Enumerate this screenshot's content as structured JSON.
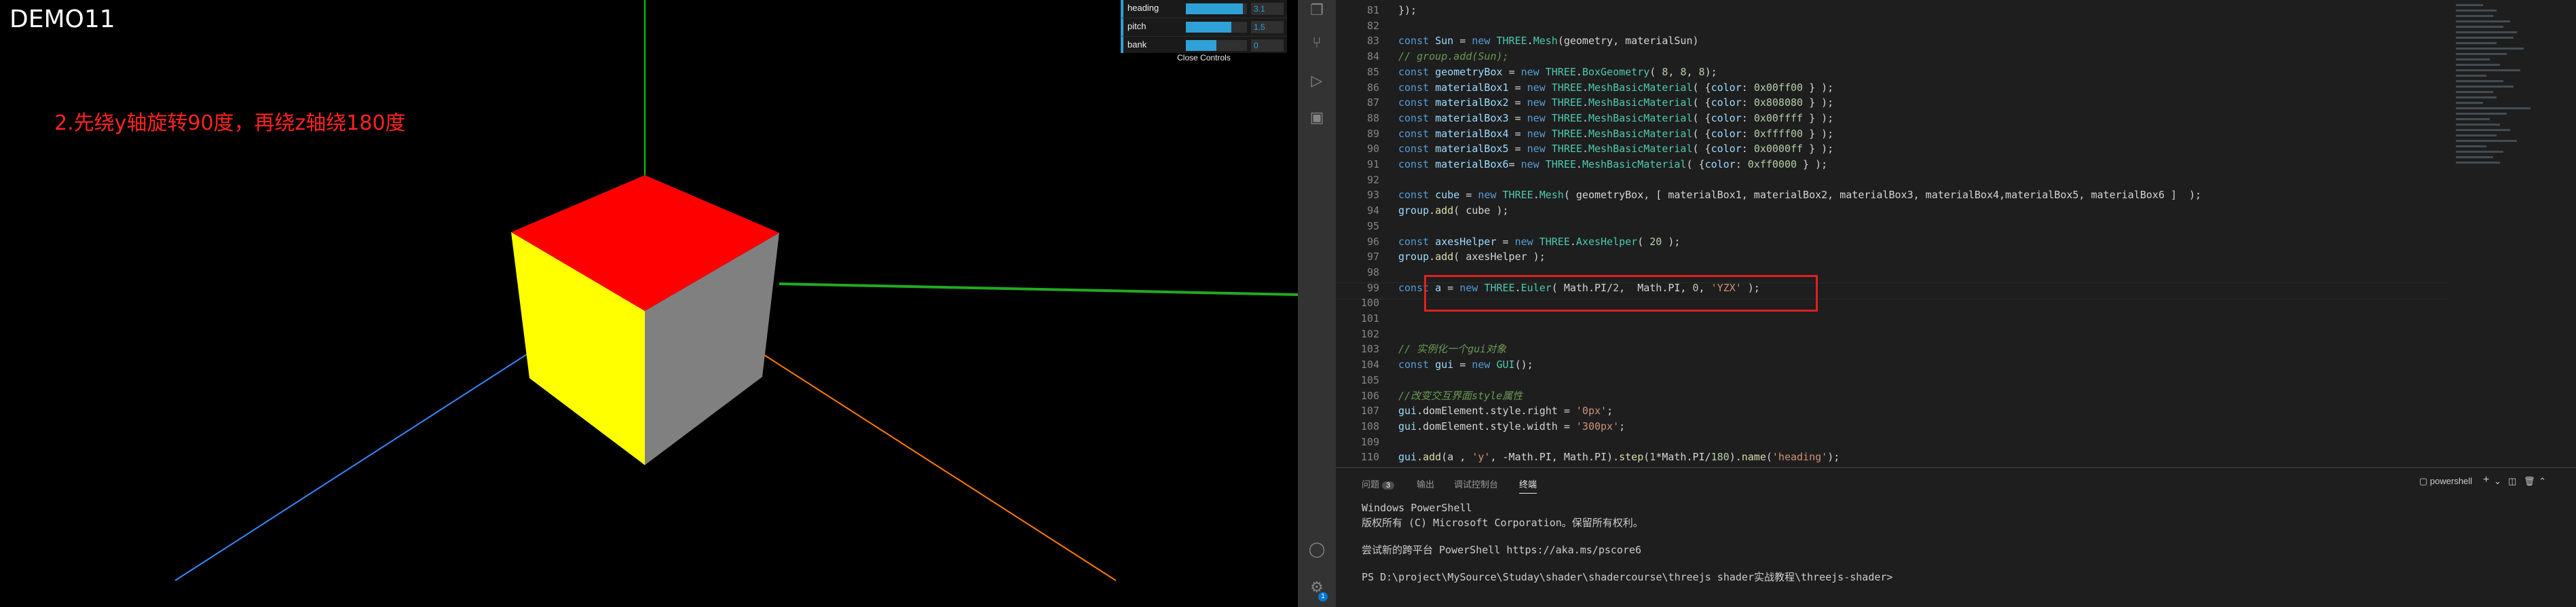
{
  "scene": {
    "title": "DEMO11",
    "annotation": "2.先绕y轴旋转90度，再绕z轴绕180度",
    "colors": {
      "top_face": "#ff0000",
      "left_face": "#ffff00",
      "right_face": "#808080",
      "x_axis": "#ff7700",
      "y_axis": "#00ff00",
      "z_axis": "#2277ff"
    }
  },
  "gui": {
    "rows": [
      {
        "label": "heading",
        "value": "3.1",
        "fill": 0.93
      },
      {
        "label": "pitch",
        "value": "1.5",
        "fill": 0.74
      },
      {
        "label": "bank",
        "value": "0",
        "fill": 0.5
      }
    ],
    "close_label": "Close Controls"
  },
  "activity_bar": {
    "icons": [
      "files-icon",
      "source-control-icon",
      "run-debug-icon",
      "extensions-icon"
    ],
    "bottom_icons": [
      "account-icon",
      "settings-gear-icon"
    ],
    "settings_badge": "1"
  },
  "editor": {
    "lines": [
      {
        "n": "81",
        "html": "<span class='cl'>});</span>"
      },
      {
        "n": "82",
        "html": ""
      },
      {
        "n": "83",
        "html": "<span class='kw'>const</span> <span class='prop'>Sun</span> <span class='cl'>=</span> <span class='kw'>new</span> <span class='cls'>THREE</span><span class='cl'>.</span><span class='cls'>Mesh</span><span class='cl'>(geometry, materialSun)</span>"
      },
      {
        "n": "84",
        "html": "<span class='cm'>// group.add(Sun);</span>"
      },
      {
        "n": "85",
        "html": "<span class='kw'>const</span> <span class='prop'>geometryBox</span> <span class='cl'>=</span> <span class='kw'>new</span> <span class='cls'>THREE</span><span class='cl'>.</span><span class='cls'>BoxGeometry</span><span class='cl'>( </span><span class='num'>8</span><span class='cl'>, </span><span class='num'>8</span><span class='cl'>, </span><span class='num'>8</span><span class='cl'>);</span>"
      },
      {
        "n": "86",
        "html": "<span class='kw'>const</span> <span class='prop'>materialBox1</span> <span class='cl'>=</span> <span class='kw'>new</span> <span class='cls'>THREE</span><span class='cl'>.</span><span class='cls'>MeshBasicMaterial</span><span class='cl'>( {</span><span class='prop'>color</span><span class='cl'>: </span><span class='hex'>0x00ff00</span><span class='cl'> } );</span>"
      },
      {
        "n": "87",
        "html": "<span class='kw'>const</span> <span class='prop'>materialBox2</span> <span class='cl'>=</span> <span class='kw'>new</span> <span class='cls'>THREE</span><span class='cl'>.</span><span class='cls'>MeshBasicMaterial</span><span class='cl'>( {</span><span class='prop'>color</span><span class='cl'>: </span><span class='hex'>0x808080</span><span class='cl'> } );</span>"
      },
      {
        "n": "88",
        "html": "<span class='kw'>const</span> <span class='prop'>materialBox3</span> <span class='cl'>=</span> <span class='kw'>new</span> <span class='cls'>THREE</span><span class='cl'>.</span><span class='cls'>MeshBasicMaterial</span><span class='cl'>( {</span><span class='prop'>color</span><span class='cl'>: </span><span class='hex'>0x00ffff</span><span class='cl'> } );</span>"
      },
      {
        "n": "89",
        "html": "<span class='kw'>const</span> <span class='prop'>materialBox4</span> <span class='cl'>=</span> <span class='kw'>new</span> <span class='cls'>THREE</span><span class='cl'>.</span><span class='cls'>MeshBasicMaterial</span><span class='cl'>( {</span><span class='prop'>color</span><span class='cl'>: </span><span class='hex'>0xffff00</span><span class='cl'> } );</span>"
      },
      {
        "n": "90",
        "html": "<span class='kw'>const</span> <span class='prop'>materialBox5</span> <span class='cl'>=</span> <span class='kw'>new</span> <span class='cls'>THREE</span><span class='cl'>.</span><span class='cls'>MeshBasicMaterial</span><span class='cl'>( {</span><span class='prop'>color</span><span class='cl'>: </span><span class='hex'>0x0000ff</span><span class='cl'> } );</span>"
      },
      {
        "n": "91",
        "html": "<span class='kw'>const</span> <span class='prop'>materialBox6</span><span class='cl'>= </span><span class='kw'>new</span> <span class='cls'>THREE</span><span class='cl'>.</span><span class='cls'>MeshBasicMaterial</span><span class='cl'>( {</span><span class='prop'>color</span><span class='cl'>: </span><span class='hex'>0xff0000</span><span class='cl'> } );</span>"
      },
      {
        "n": "92",
        "html": ""
      },
      {
        "n": "93",
        "html": "<span class='kw'>const</span> <span class='prop'>cube</span> <span class='cl'>=</span> <span class='kw'>new</span> <span class='cls'>THREE</span><span class='cl'>.</span><span class='cls'>Mesh</span><span class='cl'>( geometryBox, [ materialBox1, materialBox2, materialBox3, materialBox4,materialBox5, materialBox6 ]  );</span>"
      },
      {
        "n": "94",
        "html": "<span class='prop'>group</span><span class='cl'>.</span><span class='fn'>add</span><span class='cl'>( cube );</span>"
      },
      {
        "n": "95",
        "html": ""
      },
      {
        "n": "96",
        "html": "<span class='kw'>const</span> <span class='prop'>axesHelper</span> <span class='cl'>=</span> <span class='kw'>new</span> <span class='cls'>THREE</span><span class='cl'>.</span><span class='cls'>AxesHelper</span><span class='cl'>( </span><span class='num'>20</span><span class='cl'> );</span>"
      },
      {
        "n": "97",
        "html": "<span class='prop'>group</span><span class='cl'>.</span><span class='fn'>add</span><span class='cl'>( axesHelper );</span>"
      },
      {
        "n": "98",
        "html": ""
      },
      {
        "n": "99",
        "html": "<span class='kw'>const</span> <span class='prop'>a</span> <span class='cl'>=</span> <span class='kw'>new</span> <span class='cls'>THREE</span><span class='cl'>.</span><span class='cls'>Euler</span><span class='cl'>( Math.PI/</span><span class='num'>2</span><span class='cl'>,  Math.PI, </span><span class='num'>0</span><span class='cl'>, </span><span class='str'>'YZX'</span><span class='cl'> );</span>"
      },
      {
        "n": "100",
        "html": ""
      },
      {
        "n": "101",
        "html": ""
      },
      {
        "n": "102",
        "html": ""
      },
      {
        "n": "103",
        "html": "<span class='cm'>// 实例化一个gui对象</span>"
      },
      {
        "n": "104",
        "html": "<span class='kw'>const</span> <span class='prop'>gui</span> <span class='cl'>=</span> <span class='kw'>new</span> <span class='cls'>GUI</span><span class='cl'>();</span>"
      },
      {
        "n": "105",
        "html": ""
      },
      {
        "n": "106",
        "html": "<span class='cm'>//改变交互界面style属性</span>"
      },
      {
        "n": "107",
        "html": "<span class='prop'>gui</span><span class='cl'>.domElement.style.right = </span><span class='str'>'0px'</span><span class='cl'>;</span>"
      },
      {
        "n": "108",
        "html": "<span class='prop'>gui</span><span class='cl'>.domElement.style.width = </span><span class='str'>'300px'</span><span class='cl'>;</span>"
      },
      {
        "n": "109",
        "html": ""
      },
      {
        "n": "110",
        "html": "<span class='prop'>gui</span><span class='cl'>.</span><span class='fn'>add</span><span class='cl'>(a , </span><span class='str'>'y'</span><span class='cl'>, -Math.PI, Math.PI).</span><span class='fn'>step</span><span class='cl'>(</span><span class='num'>1</span><span class='cl'>*Math.PI/</span><span class='num'>180</span><span class='cl'>).</span><span class='fn'>name</span><span class='cl'>(</span><span class='str'>'heading'</span><span class='cl'>);</span>"
      }
    ]
  },
  "panel": {
    "tabs": [
      {
        "label": "问题",
        "badge": "3",
        "active": false
      },
      {
        "label": "输出",
        "active": false
      },
      {
        "label": "调试控制台",
        "active": false
      },
      {
        "label": "终端",
        "active": true
      }
    ],
    "shell_label": "powershell",
    "terminal_lines": [
      "Windows PowerShell",
      "版权所有 (C) Microsoft Corporation。保留所有权利。",
      "",
      "尝试新的跨平台 PowerShell https://aka.ms/pscore6",
      "",
      "PS D:\\project\\MySource\\Studay\\shader\\shadercourse\\threejs shader实战教程\\threejs-shader>"
    ]
  }
}
